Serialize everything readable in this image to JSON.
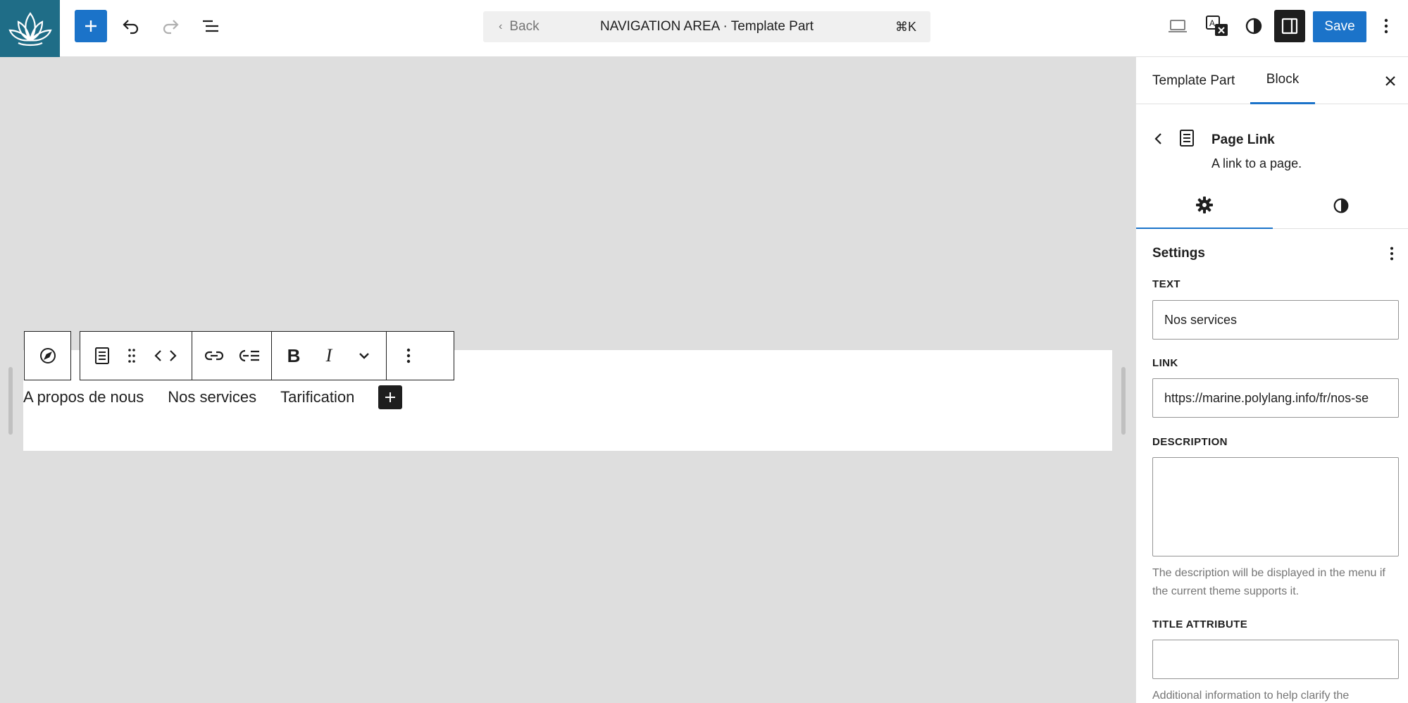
{
  "header": {
    "command_back": "Back",
    "command_title": "NAVIGATION AREA · Template Part",
    "command_shortcut": "⌘K",
    "save_label": "Save"
  },
  "canvas": {
    "nav_links": [
      "A propos de nous",
      "Nos services",
      "Tarification"
    ]
  },
  "sidebar": {
    "tabs": [
      "Template Part",
      "Block"
    ],
    "active_tab": "Block",
    "block_card": {
      "title": "Page Link",
      "description": "A link to a page."
    },
    "settings_title": "Settings",
    "fields": {
      "text_label": "TEXT",
      "text_value": "Nos services",
      "link_label": "LINK",
      "link_value": "https://marine.polylang.info/fr/nos-se",
      "description_label": "DESCRIPTION",
      "description_help": "The description will be displayed in the menu if the current theme supports it.",
      "title_attr_label": "TITLE ATTRIBUTE",
      "title_attr_help": "Additional information to help clarify the"
    }
  },
  "colors": {
    "accent": "#1b73c9",
    "logo_bg": "#1f6d87",
    "canvas_bg": "#dedede"
  }
}
